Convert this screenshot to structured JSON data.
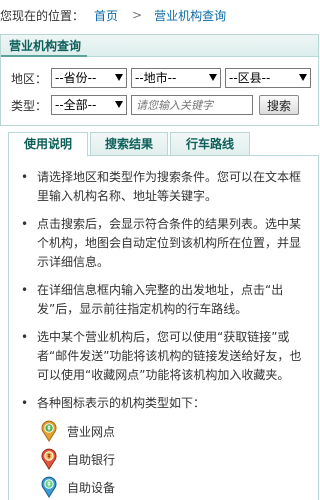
{
  "breadcrumb": {
    "prefix": "您现在的位置：",
    "home": "首页",
    "separator": ">",
    "current": "营业机构查询"
  },
  "panel": {
    "title": "营业机构查询",
    "region_label": "地区：",
    "province": "--省份--",
    "city": "--地市--",
    "district": "--区县--",
    "type_label": "类型：",
    "type": "--全部--",
    "keyword_placeholder": "请您输入关键字",
    "search_button": "搜索"
  },
  "tabs": [
    "使用说明",
    "搜索结果",
    "行车路线"
  ],
  "instructions": [
    "请选择地区和类型作为搜索条件。您可以在文本框里输入机构名称、地址等关键字。",
    "点击搜索后，会显示符合条件的结果列表。选中某个机构，地图会自动定位到该机构所在位置，并显示详细信息。",
    "在详细信息框内输入完整的出发地址，点击“出发”后，显示前往指定机构的行车路线。",
    "选中某个营业机构后，您可以使用“获取链接”或者“邮件发送”功能将该机构的链接发送给好友，也可以使用“收藏网点”功能将该机构加入收藏夹。",
    "各种图标表示的机构类型如下："
  ],
  "legend": [
    {
      "label": "营业网点",
      "icon": "branch-marker-icon",
      "color": "#e8a030"
    },
    {
      "label": "自助银行",
      "icon": "self-service-bank-marker-icon",
      "color": "#e0573a"
    },
    {
      "label": "自助设备",
      "icon": "self-service-device-marker-icon",
      "color": "#3a9bd6"
    }
  ],
  "colors": {
    "accent": "#0e5f5a",
    "border": "#b9d7d4",
    "link": "#0a6aa8"
  }
}
